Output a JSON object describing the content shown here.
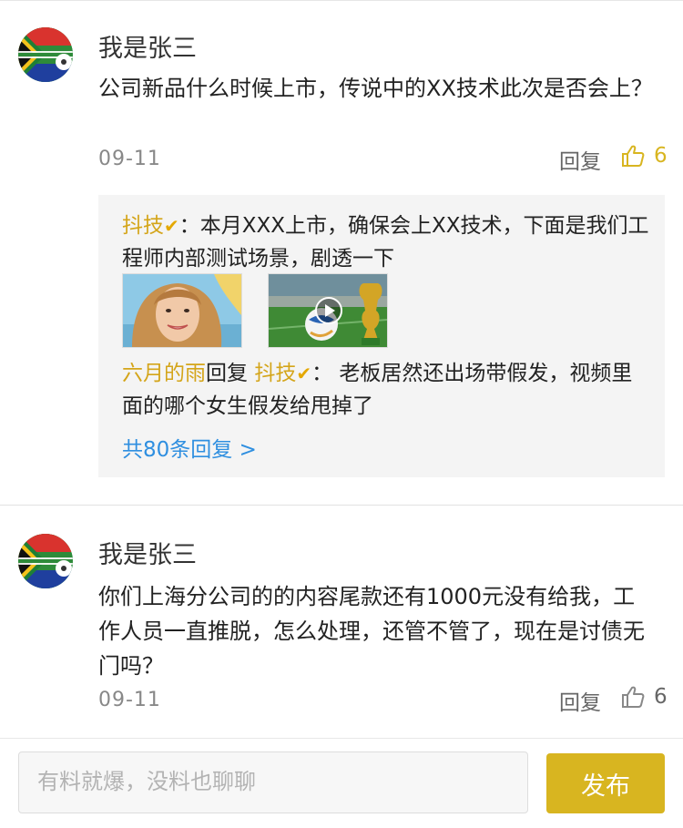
{
  "colors": {
    "accent_gold": "#d8b520",
    "link_blue": "#2f8fe0",
    "name_gold": "#d4a51a"
  },
  "comments": [
    {
      "username": "我是张三",
      "content": "公司新品什么时候上市，传说中的XX技术此次是否会上？",
      "date": "09-11",
      "reply_label": "回复",
      "like_count": "6",
      "like_active": true,
      "replies": {
        "r1_name": "抖技",
        "r1_colon": "：",
        "r1_text": "本月XXX上市，确保会上XX技术，下面是我们工程师内部测试场景，剧透一下",
        "r2_name": "六月的雨",
        "r2_mid": "回复",
        "r2_target": "抖技",
        "r2_colon": "：",
        "r2_text": "老板居然还出场带假发，视频里面的哪个女生假发给甩掉了",
        "more_link": "共80条回复 >"
      }
    },
    {
      "username": "我是张三",
      "content": "你们上海分公司的的内容尾款还有1000元没有给我，工作人员一直推脱，怎么处理，还管不管了，现在是讨债无门吗？",
      "date": "09-11",
      "reply_label": "回复",
      "like_count": "6",
      "like_active": false
    }
  ],
  "input": {
    "placeholder": "有料就爆，没料也聊聊"
  },
  "submit_label": "发布",
  "icons": [
    "avatar-flag-icon",
    "thumbs-up-icon",
    "verified-icon",
    "play-icon"
  ]
}
